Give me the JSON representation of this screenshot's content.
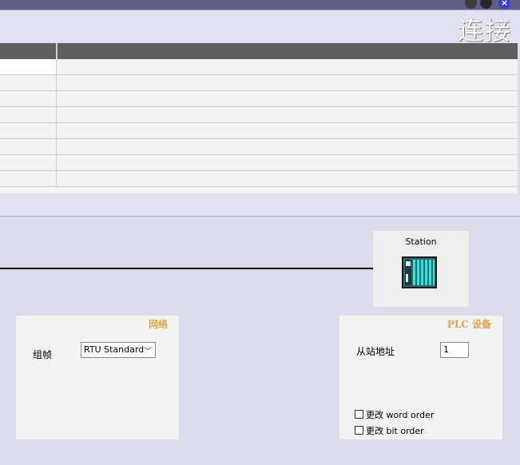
{
  "header": {
    "title": "连接"
  },
  "table": {
    "row_count": 8
  },
  "station": {
    "label": "Station",
    "icon": "plc-device-icon"
  },
  "network_panel": {
    "title": "网络",
    "framing_label": "组帧",
    "framing_value": "RTU Standard"
  },
  "plc_panel": {
    "title": "PLC 设备",
    "slave_address_label": "从站地址",
    "slave_address_value": "1",
    "change_word_order_label": "更改 word order",
    "change_bit_order_label": "更改 bit order"
  },
  "colors": {
    "panel_title": "#e0a64a",
    "accent_border": "#a9a8d6",
    "table_header": "#5e5e5e"
  }
}
